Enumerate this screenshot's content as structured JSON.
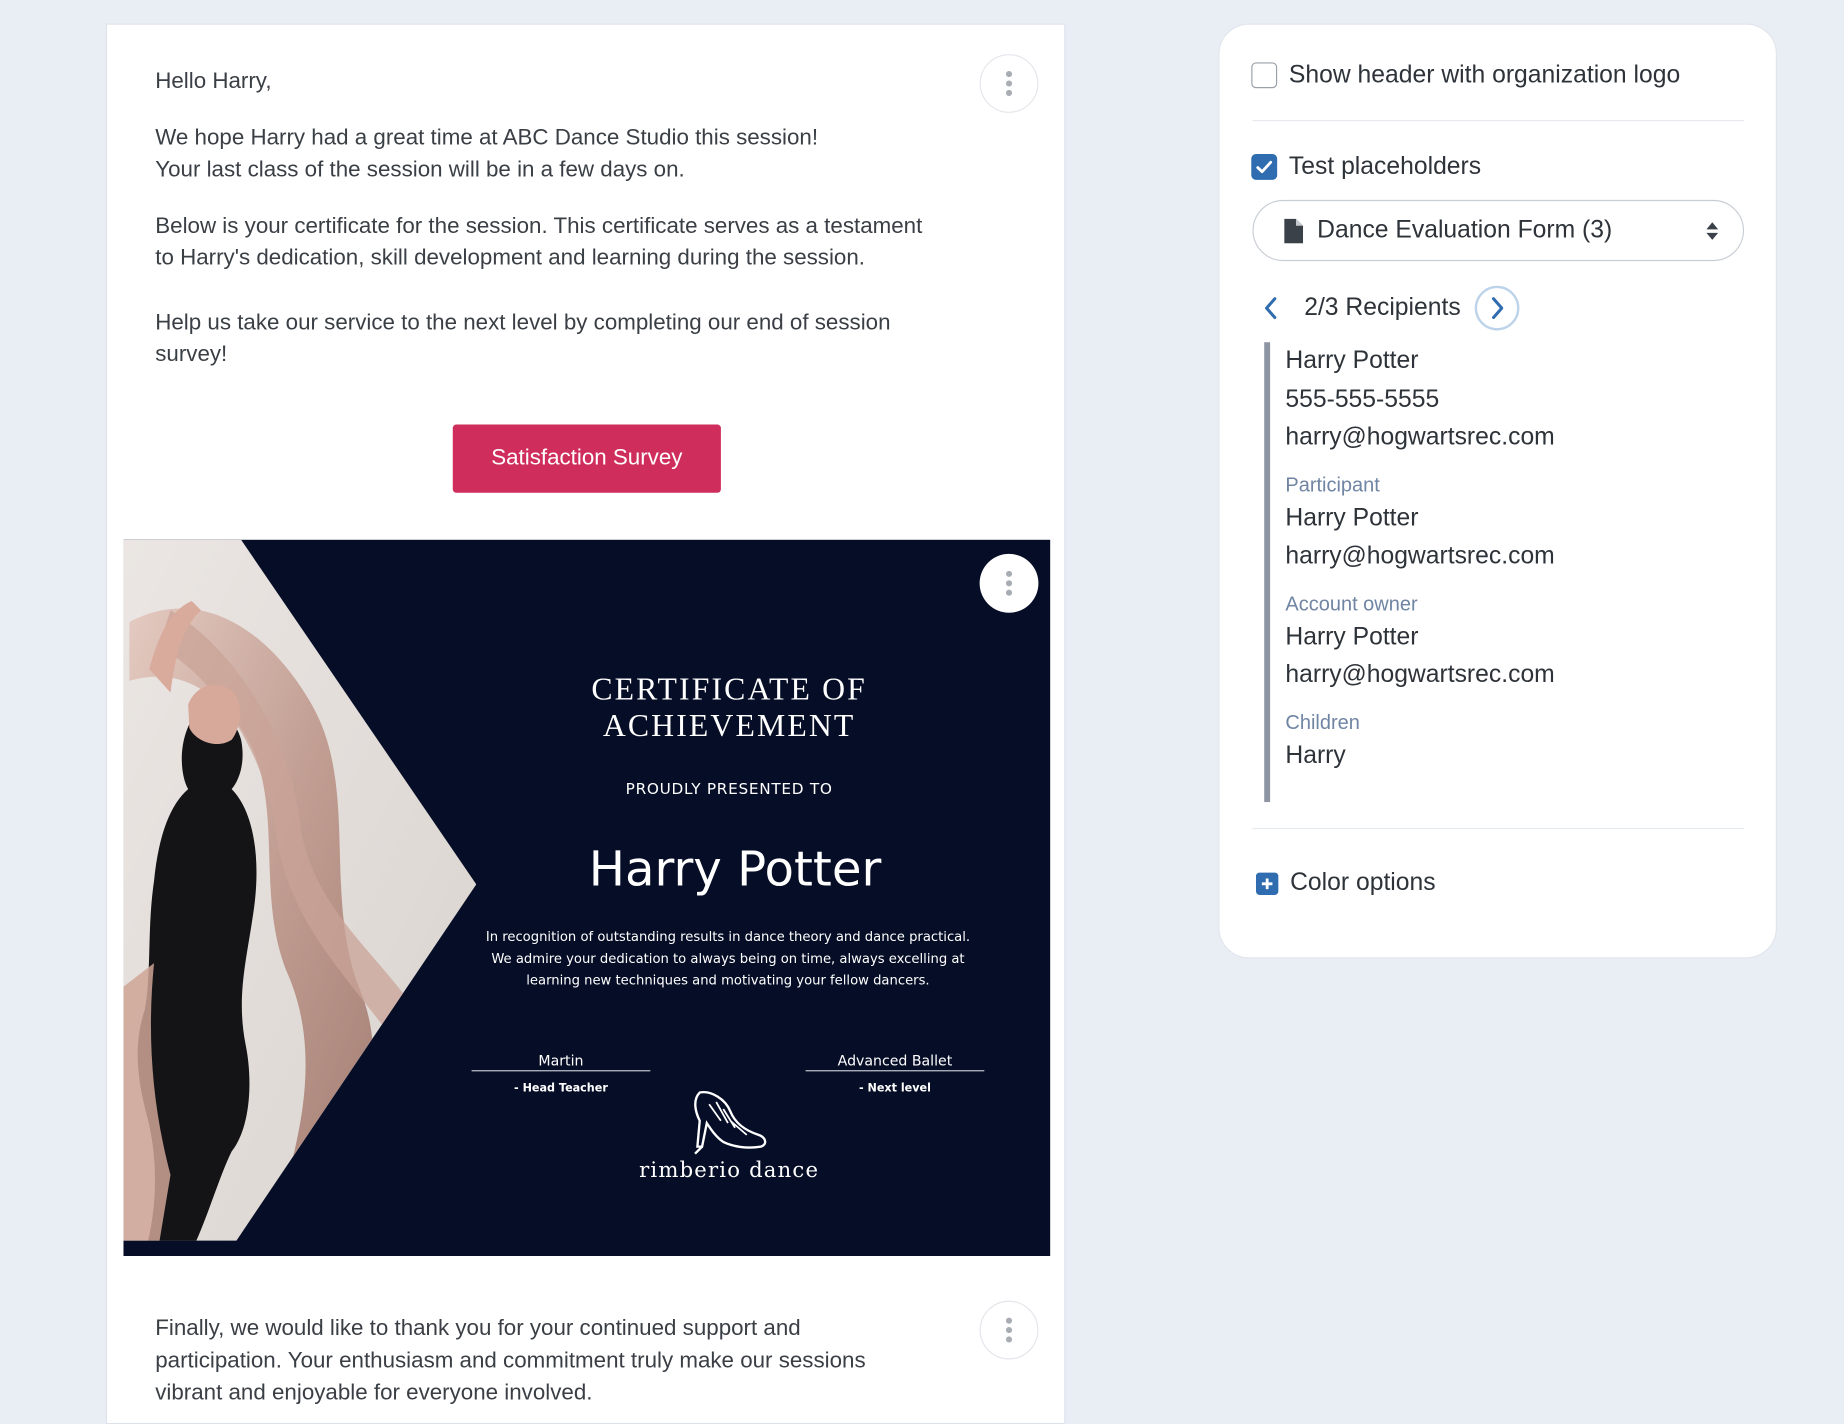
{
  "email": {
    "greeting": "Hello Harry,",
    "para1_line1": "We hope Harry had a great time at ABC Dance Studio this session!",
    "para1_line2": "Your last class of the session will be in a few days on.",
    "para2_line1": "Below is your certificate for the session. This certificate serves as a testament",
    "para2_line2": "to Harry's dedication, skill development and learning during the session.",
    "para3_line1": "Help us take our service to the next level by completing our end of session",
    "para3_line2": "survey!",
    "survey_button": "Satisfaction Survey",
    "closing_line1": "Finally, we would like to thank you for your continued support and",
    "closing_line2": "participation. Your enthusiasm and commitment truly make our sessions",
    "closing_line3": "vibrant and enjoyable for everyone involved."
  },
  "certificate": {
    "title": "CERTIFICATE OF ACHIEVEMENT",
    "presented": "PROUDLY PRESENTED TO",
    "name": "Harry Potter",
    "desc_line1": "In recognition of outstanding results in dance theory and dance practical.",
    "desc_line2": "We admire your dedication to always being on time, always excelling at",
    "desc_line3": "learning new techniques and motivating your fellow dancers.",
    "sig_left_name": "Martin",
    "sig_left_role": "- Head Teacher",
    "sig_right_name": "Advanced Ballet",
    "sig_right_role": "- Next level",
    "brand": "rimberio dance",
    "background_color": "#060d26"
  },
  "panel": {
    "show_header_label": "Show header with organization logo",
    "show_header_checked": false,
    "test_placeholders_label": "Test placeholders",
    "test_placeholders_checked": true,
    "form_select_value": "Dance Evaluation Form (3)",
    "recipients_label": "2/3 Recipients",
    "recipient": {
      "name": "Harry Potter",
      "phone": "555-555-5555",
      "email": "harry@hogwartsrec.com"
    },
    "participant_label": "Participant",
    "participant": {
      "name": "Harry Potter",
      "email": "harry@hogwartsrec.com"
    },
    "account_owner_label": "Account owner",
    "account_owner": {
      "name": "Harry Potter",
      "email": "harry@hogwartsrec.com"
    },
    "children_label": "Children",
    "children": "Harry",
    "color_options_label": "Color options"
  },
  "colors": {
    "accent": "#cf2e5c",
    "primary_blue": "#2f6cb0",
    "page_bg": "#e9edf4",
    "muted_label": "#7085a3"
  },
  "icons": [
    "kebab-menu-icon",
    "checkbox-icon",
    "check-icon",
    "document-icon",
    "sort-caret-icon",
    "chevron-left-icon",
    "chevron-right-icon",
    "plus-square-icon",
    "dance-shoe-icon"
  ]
}
